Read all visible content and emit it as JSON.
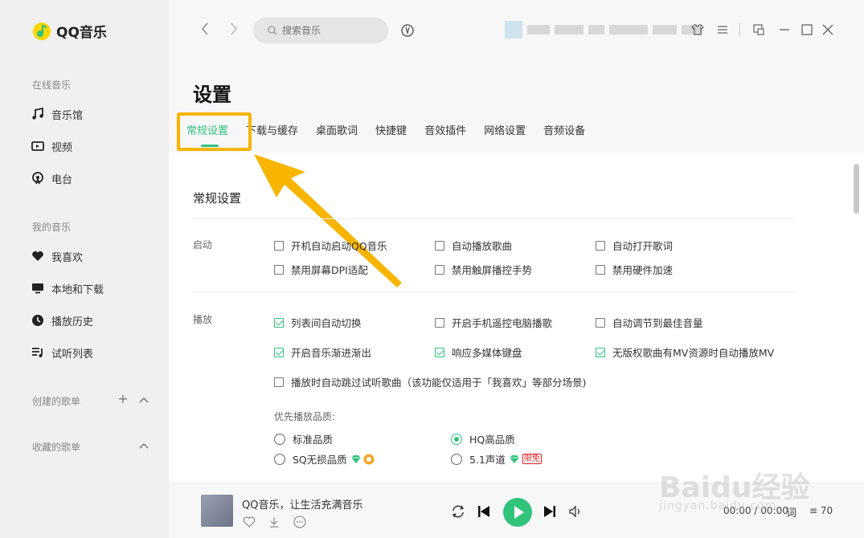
{
  "app": {
    "name": "QQ音乐"
  },
  "sidebar": {
    "online_section": "在线音乐",
    "online_items": [
      {
        "label": "音乐馆",
        "icon": "music-note-icon"
      },
      {
        "label": "视频",
        "icon": "video-icon"
      },
      {
        "label": "电台",
        "icon": "radio-icon"
      }
    ],
    "mine_section": "我的音乐",
    "mine_items": [
      {
        "label": "我喜欢",
        "icon": "heart-icon"
      },
      {
        "label": "本地和下载",
        "icon": "monitor-icon"
      },
      {
        "label": "播放历史",
        "icon": "clock-icon"
      },
      {
        "label": "试听列表",
        "icon": "playlist-icon"
      }
    ],
    "created_section": "创建的歌单",
    "collected_section": "收藏的歌单"
  },
  "topbar": {
    "search_placeholder": "搜索音乐"
  },
  "settings": {
    "title": "设置",
    "tabs": [
      "常规设置",
      "下载与缓存",
      "桌面歌词",
      "快捷键",
      "音效插件",
      "网络设置",
      "音频设备"
    ],
    "active_tab": 0,
    "section_title": "常规设置",
    "startup": {
      "label": "启动",
      "options": [
        {
          "label": "开机自动启动QQ音乐",
          "checked": false
        },
        {
          "label": "自动播放歌曲",
          "checked": false
        },
        {
          "label": "自动打开歌词",
          "checked": false
        },
        {
          "label": "禁用屏幕DPI适配",
          "checked": false
        },
        {
          "label": "禁用触屏播控手势",
          "checked": false
        },
        {
          "label": "禁用硬件加速",
          "checked": false
        }
      ]
    },
    "playback": {
      "label": "播放",
      "options": [
        {
          "label": "列表间自动切换",
          "checked": true
        },
        {
          "label": "开启手机遥控电脑播歌",
          "checked": false
        },
        {
          "label": "自动调节到最佳音量",
          "checked": false
        },
        {
          "label": "开启音乐渐进渐出",
          "checked": true
        },
        {
          "label": "响应多媒体键盘",
          "checked": true
        },
        {
          "label": "无版权歌曲有MV资源时自动播放MV",
          "checked": true
        },
        {
          "label": "播放时自动跳过试听歌曲（该功能仅适用于「我喜欢」等部分场景)",
          "checked": false
        }
      ],
      "quality_label": "优先播放品质:",
      "quality_options": [
        {
          "label": "标准品质",
          "selected": false
        },
        {
          "label": "HQ高品质",
          "selected": true
        },
        {
          "label": "SQ无损品质",
          "selected": false
        },
        {
          "label": "5.1声道",
          "selected": false,
          "tag": "限免"
        }
      ]
    }
  },
  "player": {
    "song": "QQ音乐，让生活充满音乐",
    "time": "00:00 / 00:00",
    "lyric": "词",
    "count": "70"
  },
  "watermark": {
    "brand": "Baidu经验",
    "url": "jingyan.baidu.com"
  },
  "colors": {
    "accent": "#31c27c",
    "highlight": "#f7b500"
  }
}
